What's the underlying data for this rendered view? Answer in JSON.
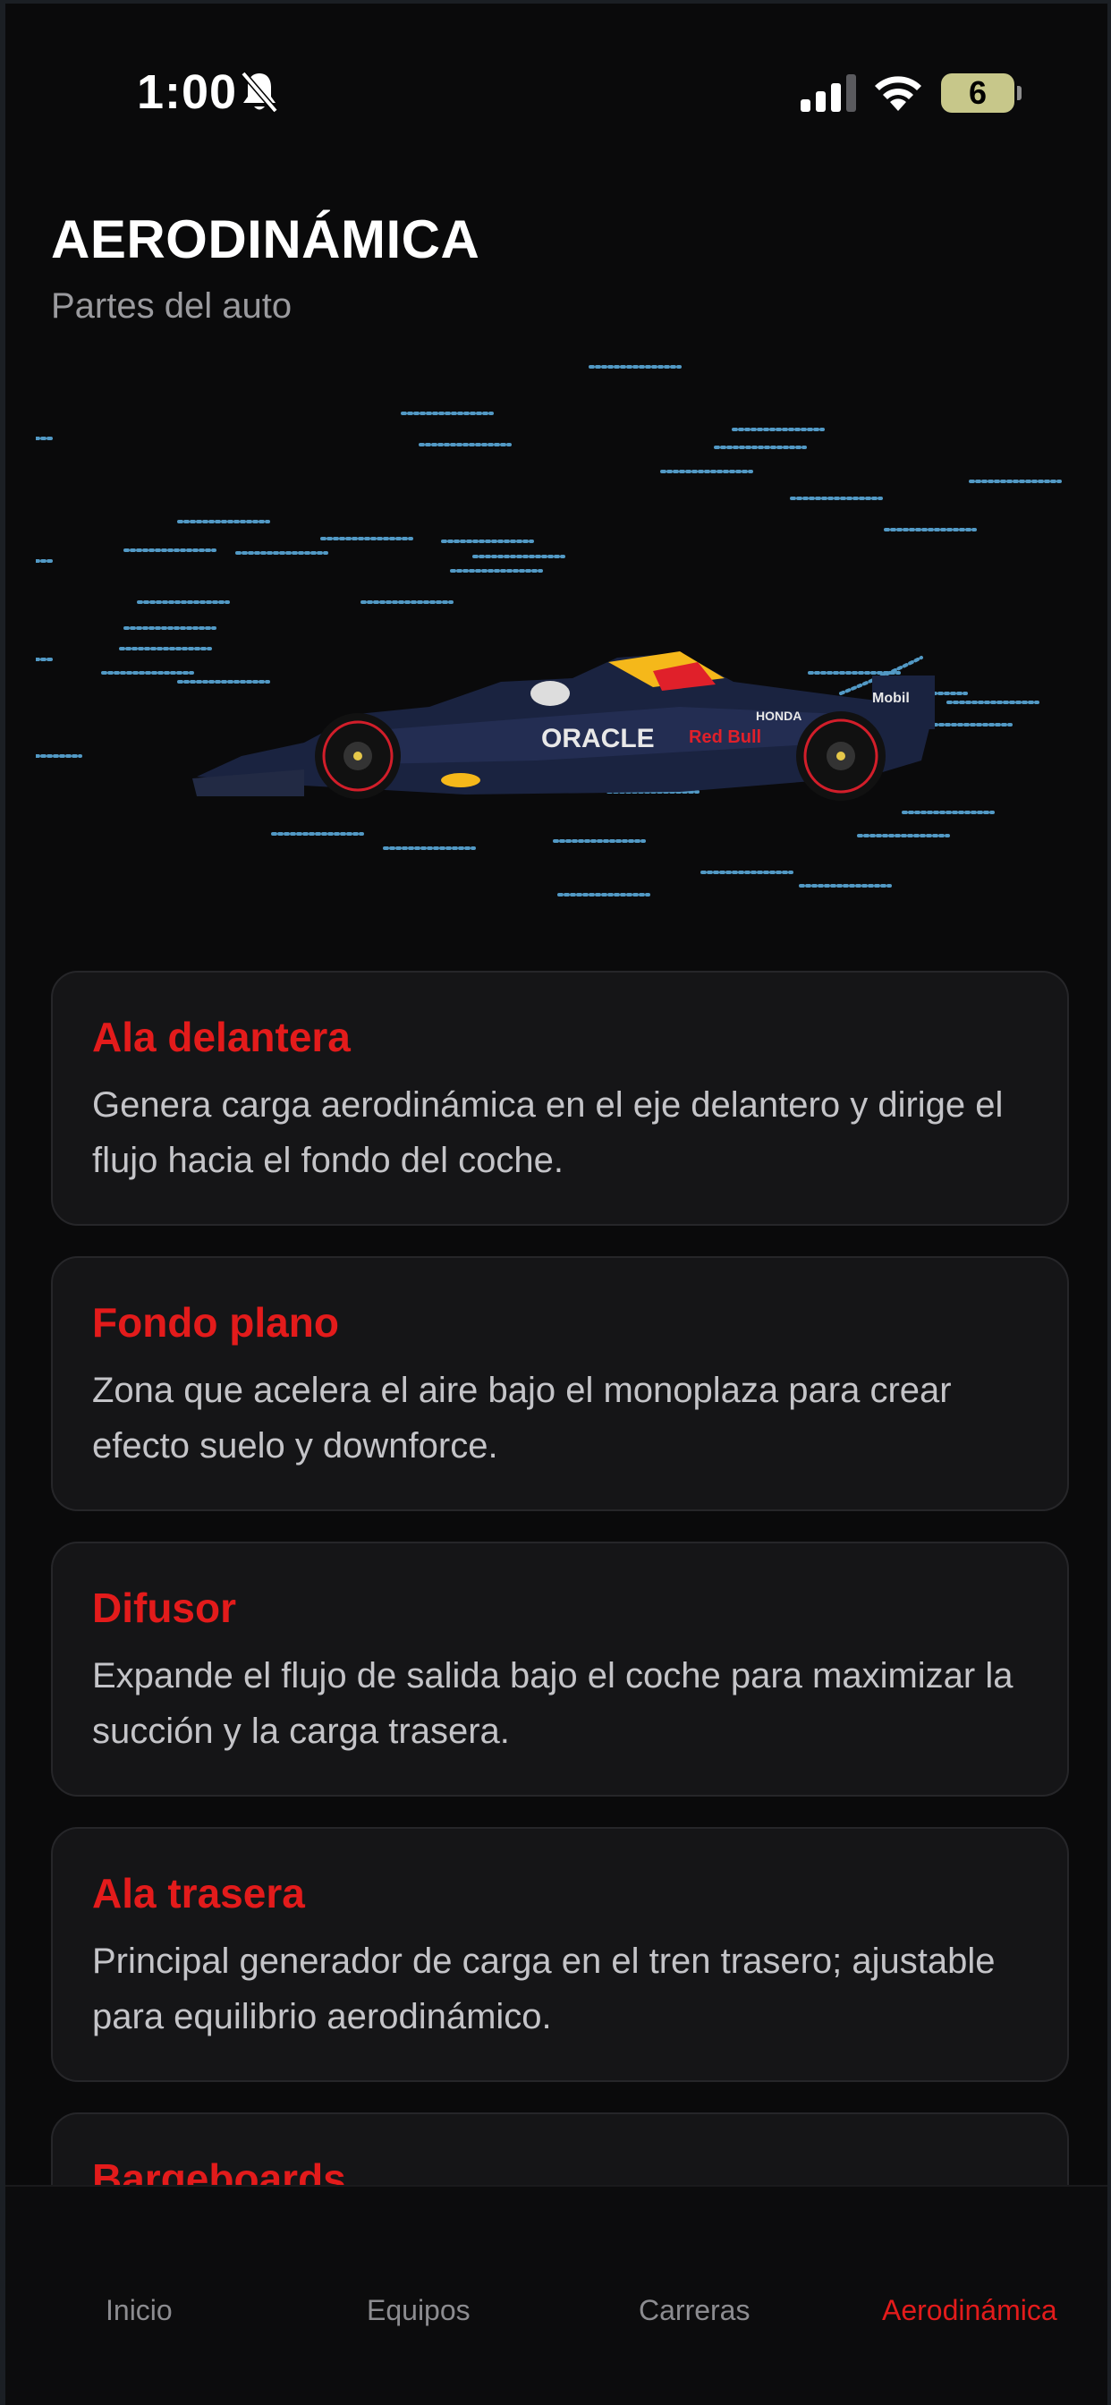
{
  "status_bar": {
    "time": "1:00",
    "battery_level": "6"
  },
  "header": {
    "title": "AERODINÁMICA",
    "subtitle": "Partes del auto"
  },
  "cards": [
    {
      "title": "Ala delantera",
      "description": "Genera carga aerodinámica en el eje delantero y dirige el flujo hacia el fondo del coche."
    },
    {
      "title": "Fondo plano",
      "description": "Zona que acelera el aire bajo el monoplaza para crear efecto suelo y downforce."
    },
    {
      "title": "Difusor",
      "description": "Expande el flujo de salida bajo el coche para maximizar la succión y la carga trasera."
    },
    {
      "title": "Ala trasera",
      "description": "Principal generador de carga en el tren trasero; ajustable para equilibrio aerodinámico."
    },
    {
      "title": "Bargeboards",
      "description": ""
    }
  ],
  "tabs": [
    {
      "label": "Inicio",
      "active": false
    },
    {
      "label": "Equipos",
      "active": false
    },
    {
      "label": "Carreras",
      "active": false
    },
    {
      "label": "Aerodinámica",
      "active": true
    }
  ],
  "colors": {
    "background": "#0a0a0b",
    "accent": "#e31b1b",
    "card_bg": "#151517",
    "airflow": "#5fb3e6"
  },
  "icons": [
    "bell-slash-icon",
    "cellular-signal-icon",
    "wifi-icon",
    "battery-icon"
  ],
  "car_livery_text": [
    "ORACLE",
    "Red Bull",
    "HONDA",
    "Mobil"
  ]
}
